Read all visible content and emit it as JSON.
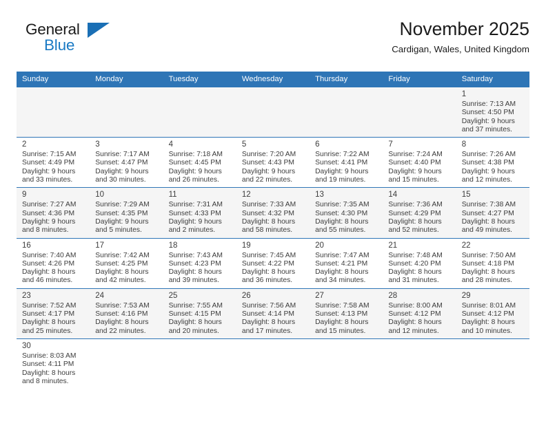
{
  "brand": {
    "name_part1": "General",
    "name_part2": "Blue",
    "flag_icon": "blue-flag-icon"
  },
  "header": {
    "title": "November 2025",
    "location": "Cardigan, Wales, United Kingdom"
  },
  "colors": {
    "header_blue": "#2e75b6",
    "brand_blue": "#1a7ac4",
    "shaded_row": "#f5f5f5",
    "text": "#3c3c3c"
  },
  "calendar": {
    "weekday_headers": [
      "Sunday",
      "Monday",
      "Tuesday",
      "Wednesday",
      "Thursday",
      "Friday",
      "Saturday"
    ],
    "weeks": [
      [
        {
          "empty": true
        },
        {
          "empty": true
        },
        {
          "empty": true
        },
        {
          "empty": true
        },
        {
          "empty": true
        },
        {
          "empty": true
        },
        {
          "day": "1",
          "sunrise": "Sunrise: 7:13 AM",
          "sunset": "Sunset: 4:50 PM",
          "daylight_line1": "Daylight: 9 hours",
          "daylight_line2": "and 37 minutes."
        }
      ],
      [
        {
          "day": "2",
          "sunrise": "Sunrise: 7:15 AM",
          "sunset": "Sunset: 4:49 PM",
          "daylight_line1": "Daylight: 9 hours",
          "daylight_line2": "and 33 minutes."
        },
        {
          "day": "3",
          "sunrise": "Sunrise: 7:17 AM",
          "sunset": "Sunset: 4:47 PM",
          "daylight_line1": "Daylight: 9 hours",
          "daylight_line2": "and 30 minutes."
        },
        {
          "day": "4",
          "sunrise": "Sunrise: 7:18 AM",
          "sunset": "Sunset: 4:45 PM",
          "daylight_line1": "Daylight: 9 hours",
          "daylight_line2": "and 26 minutes."
        },
        {
          "day": "5",
          "sunrise": "Sunrise: 7:20 AM",
          "sunset": "Sunset: 4:43 PM",
          "daylight_line1": "Daylight: 9 hours",
          "daylight_line2": "and 22 minutes."
        },
        {
          "day": "6",
          "sunrise": "Sunrise: 7:22 AM",
          "sunset": "Sunset: 4:41 PM",
          "daylight_line1": "Daylight: 9 hours",
          "daylight_line2": "and 19 minutes."
        },
        {
          "day": "7",
          "sunrise": "Sunrise: 7:24 AM",
          "sunset": "Sunset: 4:40 PM",
          "daylight_line1": "Daylight: 9 hours",
          "daylight_line2": "and 15 minutes."
        },
        {
          "day": "8",
          "sunrise": "Sunrise: 7:26 AM",
          "sunset": "Sunset: 4:38 PM",
          "daylight_line1": "Daylight: 9 hours",
          "daylight_line2": "and 12 minutes."
        }
      ],
      [
        {
          "day": "9",
          "sunrise": "Sunrise: 7:27 AM",
          "sunset": "Sunset: 4:36 PM",
          "daylight_line1": "Daylight: 9 hours",
          "daylight_line2": "and 8 minutes."
        },
        {
          "day": "10",
          "sunrise": "Sunrise: 7:29 AM",
          "sunset": "Sunset: 4:35 PM",
          "daylight_line1": "Daylight: 9 hours",
          "daylight_line2": "and 5 minutes."
        },
        {
          "day": "11",
          "sunrise": "Sunrise: 7:31 AM",
          "sunset": "Sunset: 4:33 PM",
          "daylight_line1": "Daylight: 9 hours",
          "daylight_line2": "and 2 minutes."
        },
        {
          "day": "12",
          "sunrise": "Sunrise: 7:33 AM",
          "sunset": "Sunset: 4:32 PM",
          "daylight_line1": "Daylight: 8 hours",
          "daylight_line2": "and 58 minutes."
        },
        {
          "day": "13",
          "sunrise": "Sunrise: 7:35 AM",
          "sunset": "Sunset: 4:30 PM",
          "daylight_line1": "Daylight: 8 hours",
          "daylight_line2": "and 55 minutes."
        },
        {
          "day": "14",
          "sunrise": "Sunrise: 7:36 AM",
          "sunset": "Sunset: 4:29 PM",
          "daylight_line1": "Daylight: 8 hours",
          "daylight_line2": "and 52 minutes."
        },
        {
          "day": "15",
          "sunrise": "Sunrise: 7:38 AM",
          "sunset": "Sunset: 4:27 PM",
          "daylight_line1": "Daylight: 8 hours",
          "daylight_line2": "and 49 minutes."
        }
      ],
      [
        {
          "day": "16",
          "sunrise": "Sunrise: 7:40 AM",
          "sunset": "Sunset: 4:26 PM",
          "daylight_line1": "Daylight: 8 hours",
          "daylight_line2": "and 46 minutes."
        },
        {
          "day": "17",
          "sunrise": "Sunrise: 7:42 AM",
          "sunset": "Sunset: 4:25 PM",
          "daylight_line1": "Daylight: 8 hours",
          "daylight_line2": "and 42 minutes."
        },
        {
          "day": "18",
          "sunrise": "Sunrise: 7:43 AM",
          "sunset": "Sunset: 4:23 PM",
          "daylight_line1": "Daylight: 8 hours",
          "daylight_line2": "and 39 minutes."
        },
        {
          "day": "19",
          "sunrise": "Sunrise: 7:45 AM",
          "sunset": "Sunset: 4:22 PM",
          "daylight_line1": "Daylight: 8 hours",
          "daylight_line2": "and 36 minutes."
        },
        {
          "day": "20",
          "sunrise": "Sunrise: 7:47 AM",
          "sunset": "Sunset: 4:21 PM",
          "daylight_line1": "Daylight: 8 hours",
          "daylight_line2": "and 34 minutes."
        },
        {
          "day": "21",
          "sunrise": "Sunrise: 7:48 AM",
          "sunset": "Sunset: 4:20 PM",
          "daylight_line1": "Daylight: 8 hours",
          "daylight_line2": "and 31 minutes."
        },
        {
          "day": "22",
          "sunrise": "Sunrise: 7:50 AM",
          "sunset": "Sunset: 4:18 PM",
          "daylight_line1": "Daylight: 8 hours",
          "daylight_line2": "and 28 minutes."
        }
      ],
      [
        {
          "day": "23",
          "sunrise": "Sunrise: 7:52 AM",
          "sunset": "Sunset: 4:17 PM",
          "daylight_line1": "Daylight: 8 hours",
          "daylight_line2": "and 25 minutes."
        },
        {
          "day": "24",
          "sunrise": "Sunrise: 7:53 AM",
          "sunset": "Sunset: 4:16 PM",
          "daylight_line1": "Daylight: 8 hours",
          "daylight_line2": "and 22 minutes."
        },
        {
          "day": "25",
          "sunrise": "Sunrise: 7:55 AM",
          "sunset": "Sunset: 4:15 PM",
          "daylight_line1": "Daylight: 8 hours",
          "daylight_line2": "and 20 minutes."
        },
        {
          "day": "26",
          "sunrise": "Sunrise: 7:56 AM",
          "sunset": "Sunset: 4:14 PM",
          "daylight_line1": "Daylight: 8 hours",
          "daylight_line2": "and 17 minutes."
        },
        {
          "day": "27",
          "sunrise": "Sunrise: 7:58 AM",
          "sunset": "Sunset: 4:13 PM",
          "daylight_line1": "Daylight: 8 hours",
          "daylight_line2": "and 15 minutes."
        },
        {
          "day": "28",
          "sunrise": "Sunrise: 8:00 AM",
          "sunset": "Sunset: 4:12 PM",
          "daylight_line1": "Daylight: 8 hours",
          "daylight_line2": "and 12 minutes."
        },
        {
          "day": "29",
          "sunrise": "Sunrise: 8:01 AM",
          "sunset": "Sunset: 4:12 PM",
          "daylight_line1": "Daylight: 8 hours",
          "daylight_line2": "and 10 minutes."
        }
      ],
      [
        {
          "day": "30",
          "sunrise": "Sunrise: 8:03 AM",
          "sunset": "Sunset: 4:11 PM",
          "daylight_line1": "Daylight: 8 hours",
          "daylight_line2": "and 8 minutes."
        },
        {
          "empty": true
        },
        {
          "empty": true
        },
        {
          "empty": true
        },
        {
          "empty": true
        },
        {
          "empty": true
        },
        {
          "empty": true
        }
      ]
    ]
  }
}
